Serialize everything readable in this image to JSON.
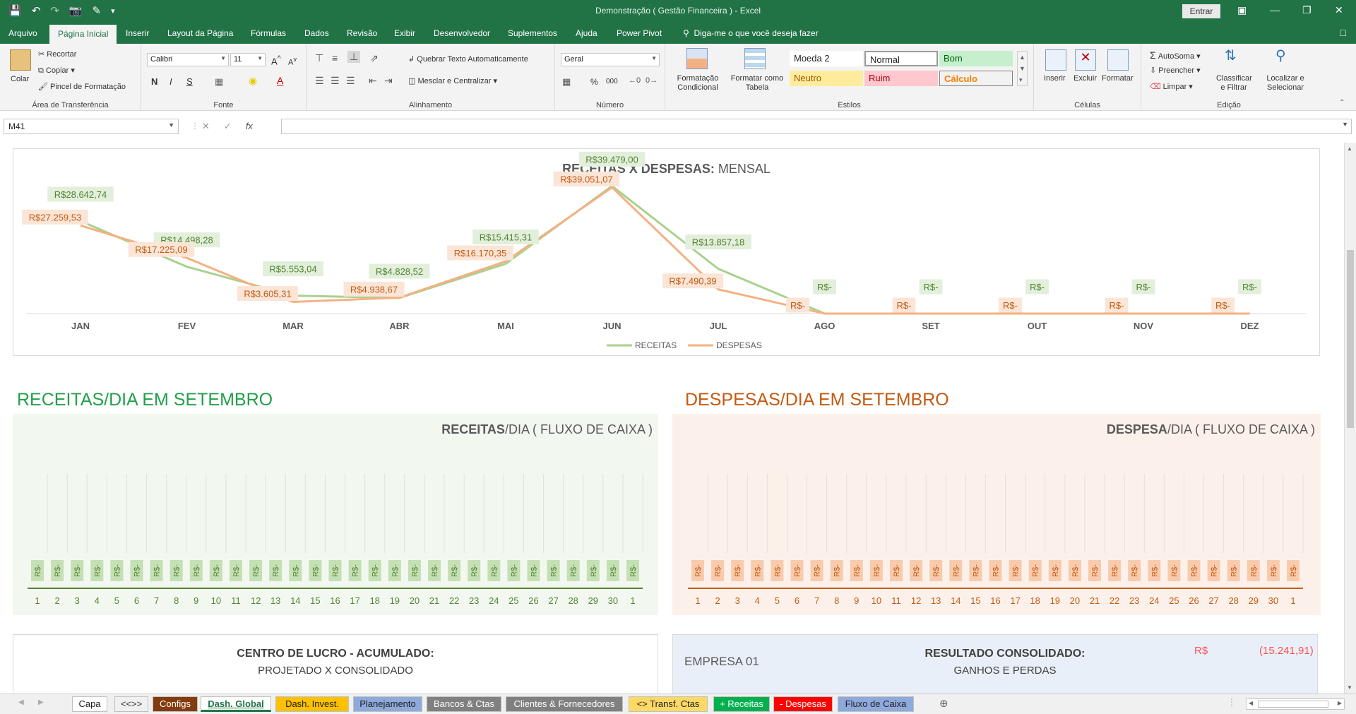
{
  "window": {
    "title": "Demonstração ( Gestão Financeira )  -  Excel",
    "signin": "Entrar"
  },
  "menu": {
    "tabs": [
      "Arquivo",
      "Página Inicial",
      "Inserir",
      "Layout da Página",
      "Fórmulas",
      "Dados",
      "Revisão",
      "Exibir",
      "Desenvolvedor",
      "Suplementos",
      "Ajuda",
      "Power Pivot"
    ],
    "active": "Página Inicial",
    "tell_me": "Diga-me o que você deseja fazer"
  },
  "ribbon": {
    "clipboard": {
      "paste": "Colar",
      "cut": "Recortar",
      "copy": "Copiar",
      "format_painter": "Pincel de Formatação",
      "label": "Área de Transferência"
    },
    "font": {
      "name": "Calibri",
      "size": "11",
      "bold": "N",
      "italic": "I",
      "underline": "S",
      "label": "Fonte"
    },
    "alignment": {
      "wrap": "Quebrar Texto Automaticamente",
      "merge": "Mesclar e Centralizar",
      "label": "Alinhamento"
    },
    "number": {
      "format": "Geral",
      "percent": "%",
      "thousands": "000",
      "label": "Número"
    },
    "styles": {
      "conditional": "Formatação Condicional",
      "as_table": "Formatar como Tabela",
      "cells": [
        "Moeda 2",
        "Normal",
        "Bom",
        "Neutro",
        "Ruim",
        "Cálculo"
      ],
      "label": "Estilos"
    },
    "cells": {
      "insert": "Inserir",
      "delete": "Excluir",
      "format": "Formatar",
      "label": "Células"
    },
    "editing": {
      "autosum": "AutoSoma",
      "fill": "Preencher",
      "clear": "Limpar",
      "sort": "Classificar e Filtrar",
      "find": "Localizar e Selecionar",
      "label": "Edição"
    }
  },
  "formula_bar": {
    "name_box": "M41",
    "fx": "fx",
    "value": ""
  },
  "chart_data": [
    {
      "type": "line",
      "title": "RECEITAS X DESPESAS: MENSAL",
      "title_bold": "RECEITAS X DESPESAS:",
      "title_rest": " MENSAL",
      "categories": [
        "JAN",
        "FEV",
        "MAR",
        "ABR",
        "MAI",
        "JUN",
        "JUL",
        "AGO",
        "SET",
        "OUT",
        "NOV",
        "DEZ"
      ],
      "series": [
        {
          "name": "RECEITAS",
          "color": "#a9d18e",
          "label_bg": "#e2efda",
          "label_color": "#548235",
          "values": [
            28642.74,
            14498.28,
            5553.04,
            4828.52,
            15415.31,
            39479.0,
            13857.18,
            0,
            0,
            0,
            0,
            0
          ],
          "labels": [
            "R$28.642,74",
            "R$14.498,28",
            "R$5.553,04",
            "R$4.828,52",
            "R$15.415,31",
            "R$39.479,00",
            "R$13.857,18",
            "R$-",
            "R$-",
            "R$-",
            "R$-",
            "R$-"
          ]
        },
        {
          "name": "DESPESAS",
          "color": "#f4b183",
          "label_bg": "#fbe5d6",
          "label_color": "#c55a11",
          "values": [
            27259.53,
            17225.09,
            3605.31,
            4938.67,
            16170.35,
            39051.07,
            7490.39,
            0,
            0,
            0,
            0,
            0
          ],
          "labels": [
            "R$27.259,53",
            "R$17.225,09",
            "R$3.605,31",
            "R$4.938,67",
            "R$16.170,35",
            "R$39.051,07",
            "R$7.490,39",
            "R$-",
            "R$-",
            "R$-",
            "R$-",
            "R$-"
          ]
        }
      ],
      "legend": "bottom"
    },
    {
      "type": "bar",
      "title_bold": "RECEITAS",
      "title_rest": "/DIA ( FLUXO DE CAIXA )",
      "categories": [
        "1",
        "2",
        "3",
        "4",
        "5",
        "6",
        "7",
        "8",
        "9",
        "10",
        "11",
        "12",
        "13",
        "14",
        "15",
        "16",
        "17",
        "18",
        "19",
        "20",
        "21",
        "22",
        "23",
        "24",
        "25",
        "26",
        "27",
        "28",
        "29",
        "30",
        "1"
      ],
      "values": [
        0,
        0,
        0,
        0,
        0,
        0,
        0,
        0,
        0,
        0,
        0,
        0,
        0,
        0,
        0,
        0,
        0,
        0,
        0,
        0,
        0,
        0,
        0,
        0,
        0,
        0,
        0,
        0,
        0,
        0,
        0
      ],
      "data_label": "R$-",
      "color": "#548235"
    },
    {
      "type": "bar",
      "title_bold": "DESPESA",
      "title_rest": "/DIA ( FLUXO DE CAIXA )",
      "categories": [
        "1",
        "2",
        "3",
        "4",
        "5",
        "6",
        "7",
        "8",
        "9",
        "10",
        "11",
        "12",
        "13",
        "14",
        "15",
        "16",
        "17",
        "18",
        "19",
        "20",
        "21",
        "22",
        "23",
        "24",
        "25",
        "26",
        "27",
        "28",
        "29",
        "30",
        "1"
      ],
      "values": [
        0,
        0,
        0,
        0,
        0,
        0,
        0,
        0,
        0,
        0,
        0,
        0,
        0,
        0,
        0,
        0,
        0,
        0,
        0,
        0,
        0,
        0,
        0,
        0,
        0,
        0,
        0,
        0,
        0,
        0,
        0
      ],
      "data_label": "R$-",
      "color": "#c55a11"
    }
  ],
  "sections": {
    "receitas_title": "RECEITAS/DIA EM SETEMBRO",
    "despesas_title": "DESPESAS/DIA EM SETEMBRO"
  },
  "bottom": {
    "lucro_title": "CENTRO DE LUCRO - ACUMULADO:",
    "lucro_sub": "PROJETADO X CONSOLIDADO",
    "empresa": "EMPRESA 01",
    "resultado_title": "RESULTADO CONSOLIDADO:",
    "resultado_sub": "GANHOS E PERDAS",
    "currency": "R$",
    "amount": "(15.241,91)"
  },
  "sheet_tabs": [
    {
      "label": "Capa",
      "bg": "#ffffff",
      "fg": "#222222"
    },
    {
      "label": "<<>>",
      "bg": "#f0f0f0",
      "fg": "#333333"
    },
    {
      "label": "Configs",
      "bg": "#843c0c",
      "fg": "#ffffff"
    },
    {
      "label": "Dash. Global",
      "bg": "#ffffff",
      "fg": "#217346",
      "active": true
    },
    {
      "label": "Dash. Invest.",
      "bg": "#ffc000",
      "fg": "#222222"
    },
    {
      "label": "Planejamento",
      "bg": "#8ea9db",
      "fg": "#222222"
    },
    {
      "label": "Bancos & Ctas",
      "bg": "#808080",
      "fg": "#ffffff"
    },
    {
      "label": "Clientes & Fornecedores",
      "bg": "#808080",
      "fg": "#ffffff"
    },
    {
      "label": "<> Transf. Ctas",
      "bg": "#ffd966",
      "fg": "#222222"
    },
    {
      "label": "+ Receitas",
      "bg": "#00b050",
      "fg": "#ffffff"
    },
    {
      "label": "- Despesas",
      "bg": "#ff0000",
      "fg": "#ffffff"
    },
    {
      "label": "Fluxo de Caixa",
      "bg": "#8ea9db",
      "fg": "#222222"
    }
  ]
}
